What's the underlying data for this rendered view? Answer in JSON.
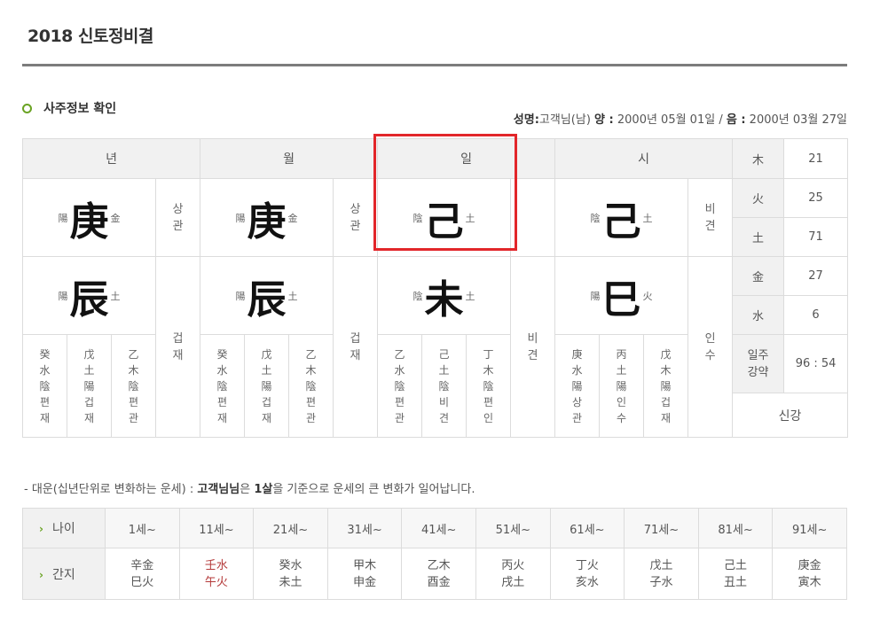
{
  "page": {
    "title": "2018 신토정비결"
  },
  "section": {
    "title": "사주정보 확인"
  },
  "birth": {
    "name_label": "성명:",
    "name_value": "고객님(남)",
    "solar_label": "양 :",
    "solar_value": "2000년 05월 01일 /",
    "lunar_label": "음 :",
    "lunar_value": "2000년 03월 27일"
  },
  "headers": {
    "year": "년",
    "month": "월",
    "day": "일",
    "hour": "시"
  },
  "stems": {
    "year": {
      "yinyang": "陽",
      "char": "庚",
      "element": "金",
      "ten_god": [
        "상",
        "관"
      ]
    },
    "month": {
      "yinyang": "陽",
      "char": "庚",
      "element": "金",
      "ten_god": [
        "상",
        "관"
      ]
    },
    "day": {
      "yinyang": "陰",
      "char": "己",
      "element": "土"
    },
    "hour": {
      "yinyang": "陰",
      "char": "己",
      "element": "土",
      "ten_god": [
        "비",
        "견"
      ]
    }
  },
  "branches": {
    "year": {
      "yinyang": "陽",
      "char": "辰",
      "element": "土",
      "ten_god": [
        "겁",
        "재"
      ],
      "hidden": [
        [
          "癸",
          "水",
          "陰",
          "편",
          "재"
        ],
        [
          "戊",
          "土",
          "陽",
          "겁",
          "재"
        ],
        [
          "乙",
          "木",
          "陰",
          "편",
          "관"
        ]
      ]
    },
    "month": {
      "yinyang": "陽",
      "char": "辰",
      "element": "土",
      "ten_god": [
        "겁",
        "재"
      ],
      "hidden": [
        [
          "癸",
          "水",
          "陰",
          "편",
          "재"
        ],
        [
          "戊",
          "土",
          "陽",
          "겁",
          "재"
        ],
        [
          "乙",
          "木",
          "陰",
          "편",
          "관"
        ]
      ]
    },
    "day": {
      "yinyang": "陰",
      "char": "未",
      "element": "土",
      "ten_god": [
        "비",
        "견"
      ],
      "hidden": [
        [
          "乙",
          "水",
          "陰",
          "편",
          "관"
        ],
        [
          "己",
          "土",
          "陰",
          "비",
          "견"
        ],
        [
          "丁",
          "木",
          "陰",
          "편",
          "인"
        ]
      ]
    },
    "hour": {
      "yinyang": "陽",
      "char": "巳",
      "element": "火",
      "ten_god": [
        "인",
        "수"
      ],
      "hidden": [
        [
          "庚",
          "水",
          "陽",
          "상",
          "관"
        ],
        [
          "丙",
          "土",
          "陽",
          "인",
          "수"
        ],
        [
          "戊",
          "木",
          "陽",
          "겁",
          "재"
        ]
      ]
    }
  },
  "elements": [
    {
      "name": "木",
      "value": "21"
    },
    {
      "name": "火",
      "value": "25"
    },
    {
      "name": "土",
      "value": "71"
    },
    {
      "name": "金",
      "value": "27"
    },
    {
      "name": "水",
      "value": "6"
    }
  ],
  "strength": {
    "label_1": "일주",
    "label_2": "강약",
    "value": "96 : 54",
    "result": "신강"
  },
  "daewoon": {
    "caption_prefix": "- 대운(십년단위로 변화하는 운세) :",
    "caption_name": "고객님님",
    "caption_mid": "은",
    "caption_age": "1살",
    "caption_suffix": "을 기준으로 운세의 큰 변화가 일어납니다.",
    "row_age_label": "나이",
    "row_gz_label": "간지",
    "ages": [
      "1세~",
      "11세~",
      "21세~",
      "31세~",
      "41세~",
      "51세~",
      "61세~",
      "71세~",
      "81세~",
      "91세~"
    ],
    "ganji": [
      [
        "辛金",
        "巳火"
      ],
      [
        "壬水",
        "午火"
      ],
      [
        "癸水",
        "未土"
      ],
      [
        "甲木",
        "申金"
      ],
      [
        "乙木",
        "酉金"
      ],
      [
        "丙火",
        "戌土"
      ],
      [
        "丁火",
        "亥水"
      ],
      [
        "戊土",
        "子水"
      ],
      [
        "己土",
        "丑土"
      ],
      [
        "庚金",
        "寅木"
      ]
    ],
    "highlight_index": 1,
    "highlight_color": "#b43a3a"
  },
  "colors": {
    "accent": "#6aa323",
    "highlight": "#e2262a"
  }
}
